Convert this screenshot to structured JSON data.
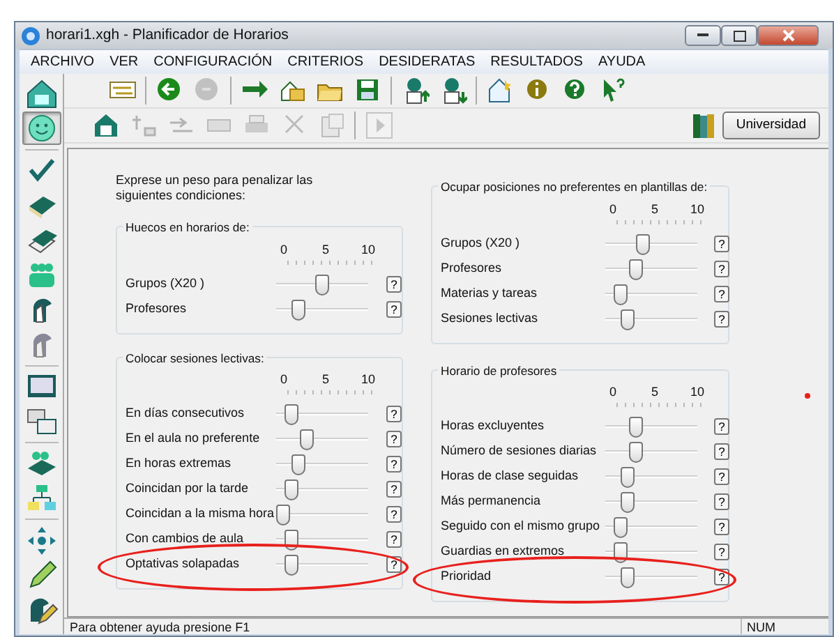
{
  "window": {
    "title": "horari1.xgh - Planificador de Horarios"
  },
  "menu": [
    "ARCHIVO",
    "VER",
    "CONFIGURACIÓN",
    "CRITERIOS",
    "DESIDERATAS",
    "RESULTADOS",
    "AYUDA"
  ],
  "toolbar_1": [
    {
      "disabled": false
    },
    {
      "disabled": false
    },
    {
      "disabled": true
    },
    {
      "disabled": false
    },
    {
      "disabled": false
    },
    {
      "disabled": false
    },
    {
      "disabled": false
    },
    {
      "disabled": false
    },
    {
      "disabled": false
    },
    {
      "disabled": false
    },
    {
      "disabled": false
    },
    {
      "disabled": false
    },
    {
      "disabled": false
    }
  ],
  "toolbar_2": [
    {
      "disabled": false
    },
    {
      "disabled": true
    },
    {
      "disabled": true
    },
    {
      "disabled": true
    },
    {
      "disabled": true
    },
    {
      "disabled": true
    },
    {
      "disabled": true
    },
    {
      "disabled": true
    }
  ],
  "profile_button": "Universidad",
  "sidebar": [
    {
      "selected": false
    },
    {
      "selected": true
    },
    {
      "selected": false
    },
    {
      "selected": false
    },
    {
      "selected": false
    },
    {
      "selected": false
    },
    {
      "selected": false
    },
    {
      "selected": false
    },
    {
      "selected": false
    },
    {
      "selected": false
    },
    {
      "selected": false
    },
    {
      "selected": false
    },
    {
      "selected": false
    },
    {
      "selected": false
    },
    {
      "selected": false
    }
  ],
  "intro": "Exprese un peso para penalizar las siguientes condiciones:",
  "groups_left": [
    {
      "title": "Huecos en horarios de:",
      "scale": [
        "0",
        "5",
        "10"
      ],
      "rows": [
        {
          "label": "Grupos  (X20 )",
          "level": 0.5,
          "help": "?",
          "highlighted": false
        },
        {
          "label": "Profesores",
          "level": 0.2,
          "help": "?",
          "highlighted": false
        }
      ]
    },
    {
      "title": "Colocar sesiones lectivas:",
      "scale": [
        "0",
        "5",
        "10"
      ],
      "rows": [
        {
          "label": "En días consecutivos",
          "level": 0.1,
          "help": "?",
          "highlighted": false
        },
        {
          "label": "En el aula no preferente",
          "level": 0.3,
          "help": "?",
          "highlighted": false
        },
        {
          "label": "En horas extremas",
          "level": 0.2,
          "help": "?",
          "highlighted": false
        },
        {
          "label": "Coincidan por la tarde",
          "level": 0.1,
          "help": "?",
          "highlighted": false
        },
        {
          "label": "Coincidan a la misma hora",
          "level": 0,
          "help": "?",
          "highlighted": false
        },
        {
          "label": "Con cambios de aula",
          "level": 0.1,
          "help": "?",
          "highlighted": false
        },
        {
          "label": "Optativas solapadas",
          "level": 0.1,
          "help": "?",
          "highlighted": true
        }
      ]
    }
  ],
  "groups_right": [
    {
      "title": "Ocupar posiciones no preferentes en plantillas de:",
      "scale": [
        "0",
        "5",
        "10"
      ],
      "rows": [
        {
          "label": "Grupos  (X20 )",
          "level": 0.4,
          "help": "?",
          "highlighted": false
        },
        {
          "label": "Profesores",
          "level": 0.3,
          "help": "?",
          "highlighted": false
        },
        {
          "label": "Materias y tareas",
          "level": 0.1,
          "help": "?",
          "highlighted": false
        },
        {
          "label": "Sesiones lectivas",
          "level": 0.2,
          "help": "?",
          "highlighted": false
        }
      ]
    },
    {
      "title": "Horario de profesores",
      "scale": [
        "0",
        "5",
        "10"
      ],
      "rows": [
        {
          "label": "Horas excluyentes",
          "level": 0.3,
          "help": "?",
          "highlighted": false
        },
        {
          "label": "Número de sesiones diarias",
          "level": 0.3,
          "help": "?",
          "highlighted": false
        },
        {
          "label": "Horas de clase seguidas",
          "level": 0.2,
          "help": "?",
          "highlighted": false
        },
        {
          "label": "Más permanencia",
          "level": 0.2,
          "help": "?",
          "highlighted": false
        },
        {
          "label": "Seguido con el mismo grupo",
          "level": 0.1,
          "help": "?",
          "highlighted": false
        },
        {
          "label": "Guardias en extremos",
          "level": 0.1,
          "help": "?",
          "highlighted": false
        },
        {
          "label": "Prioridad",
          "level": 0.2,
          "help": "?",
          "highlighted": true
        }
      ]
    }
  ],
  "annotation_dot": {
    "color": "#e8201c"
  },
  "status_bar": [
    "Para obtener ayuda presione F1",
    "NUM"
  ]
}
